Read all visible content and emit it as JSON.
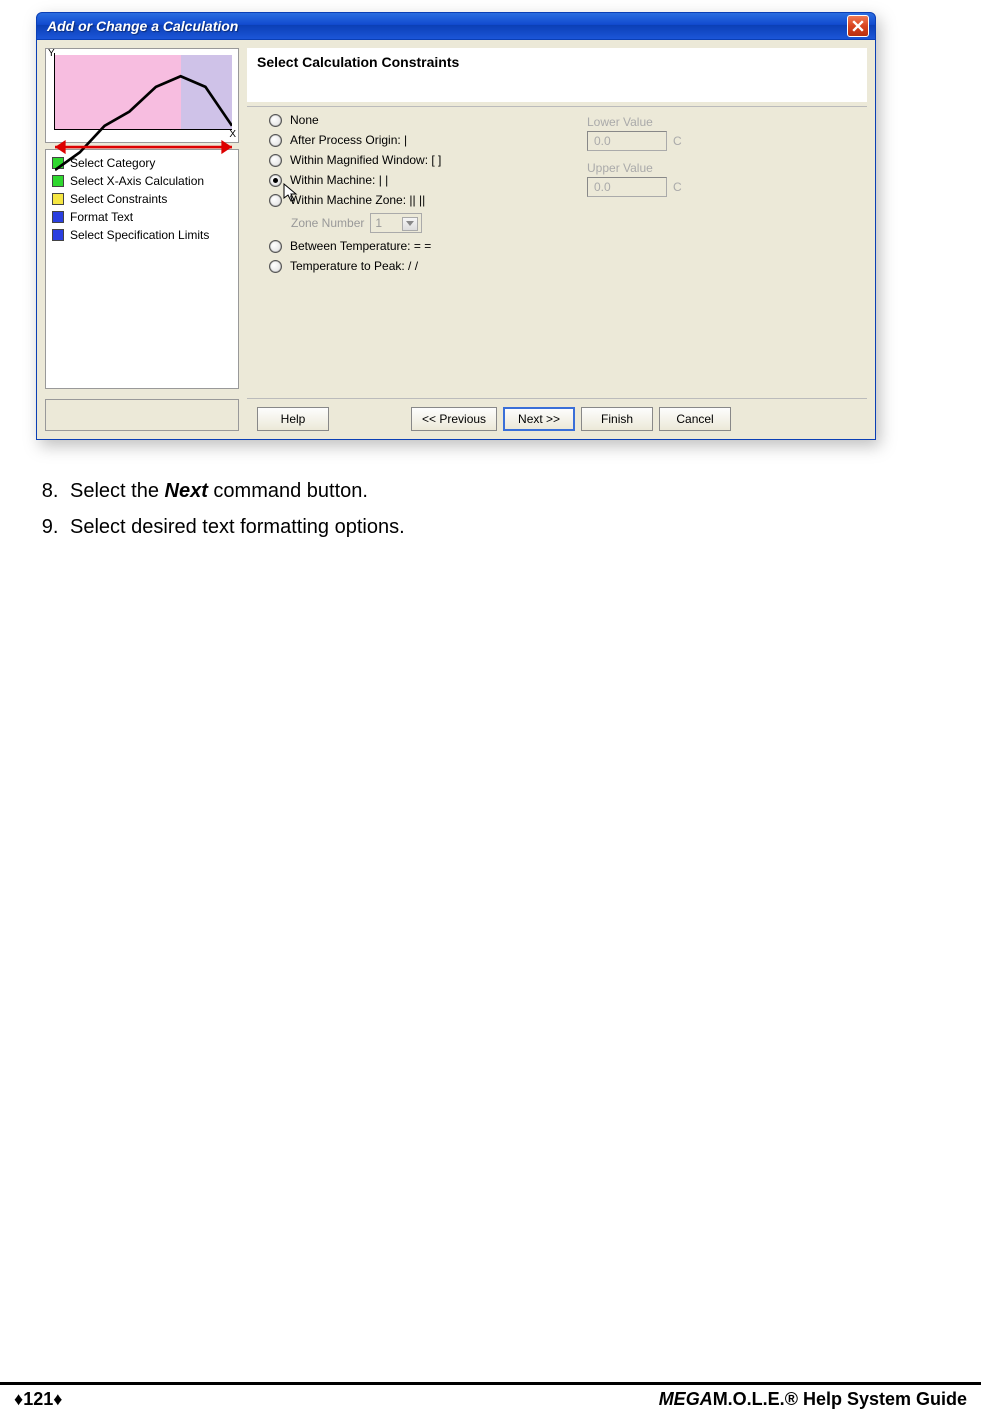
{
  "dialog": {
    "title": "Add or Change a Calculation",
    "heading": "Select Calculation Constraints",
    "steps": [
      {
        "label": "Select Category",
        "swatch": "sw-green"
      },
      {
        "label": "Select X-Axis Calculation",
        "swatch": "sw-green"
      },
      {
        "label": "Select Constraints",
        "swatch": "sw-yellow"
      },
      {
        "label": "Format Text",
        "swatch": "sw-blue"
      },
      {
        "label": "Select Specification Limits",
        "swatch": "sw-blue"
      }
    ],
    "radios": [
      {
        "label": "None",
        "selected": false
      },
      {
        "label": "After Process Origin: |",
        "selected": false
      },
      {
        "label": "Within Magnified Window: [  ]",
        "selected": false
      },
      {
        "label": "Within Machine: |  |",
        "selected": true
      },
      {
        "label": "Within Machine Zone: ||  ||",
        "selected": false
      }
    ],
    "zone_label": "Zone Number",
    "zone_value": "1",
    "radios_after": [
      {
        "label": "Between Temperature: =  =",
        "selected": false
      },
      {
        "label": "Temperature to Peak: /  /",
        "selected": false
      }
    ],
    "lower_label": "Lower Value",
    "lower_value": "0.0",
    "lower_unit": "C",
    "upper_label": "Upper Value",
    "upper_value": "0.0",
    "upper_unit": "C",
    "buttons": {
      "help": "Help",
      "previous": "<< Previous",
      "next": "Next >>",
      "finish": "Finish",
      "cancel": "Cancel"
    },
    "thumb": {
      "y": "Y",
      "x": "X"
    }
  },
  "chart_data": {
    "type": "line",
    "title": "",
    "xlabel": "X",
    "ylabel": "Y",
    "x": [
      0,
      1,
      2,
      3,
      4,
      5,
      6,
      7
    ],
    "values": [
      18,
      28,
      45,
      55,
      70,
      78,
      72,
      48
    ],
    "ylim": [
      0,
      90
    ],
    "regions": [
      {
        "color": "#f7bde0",
        "from": 0,
        "to": 5
      },
      {
        "color": "#cfc2e8",
        "from": 5,
        "to": 7
      }
    ],
    "hline": 30
  },
  "instructions": {
    "start": 8,
    "items": [
      {
        "prefix": "Select the ",
        "bold": "Next",
        "suffix": " command button."
      },
      {
        "prefix": "Select desired text formatting options.",
        "bold": "",
        "suffix": ""
      }
    ]
  },
  "footer": {
    "page": "121",
    "mega": "MEGA",
    "rest": "M.O.L.E.® Help System Guide"
  }
}
